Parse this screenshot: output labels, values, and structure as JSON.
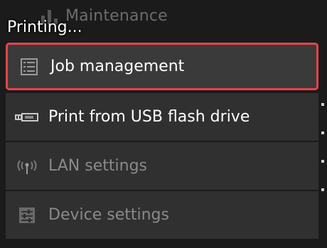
{
  "header": {
    "title": "Maintenance",
    "status": "Printing..."
  },
  "menu": {
    "items": [
      {
        "label": "Job management",
        "icon": "list-icon",
        "selected": true,
        "enabled": true
      },
      {
        "label": "Print from USB flash drive",
        "icon": "usb-icon",
        "selected": false,
        "enabled": true
      },
      {
        "label": "LAN settings",
        "icon": "wireless-antenna-icon",
        "selected": false,
        "enabled": false
      },
      {
        "label": "Device settings",
        "icon": "sliders-icon",
        "selected": false,
        "enabled": false
      }
    ]
  },
  "colors": {
    "selection_border": "#e8444a",
    "background": "#1b1b1b",
    "item_background": "#303030"
  }
}
